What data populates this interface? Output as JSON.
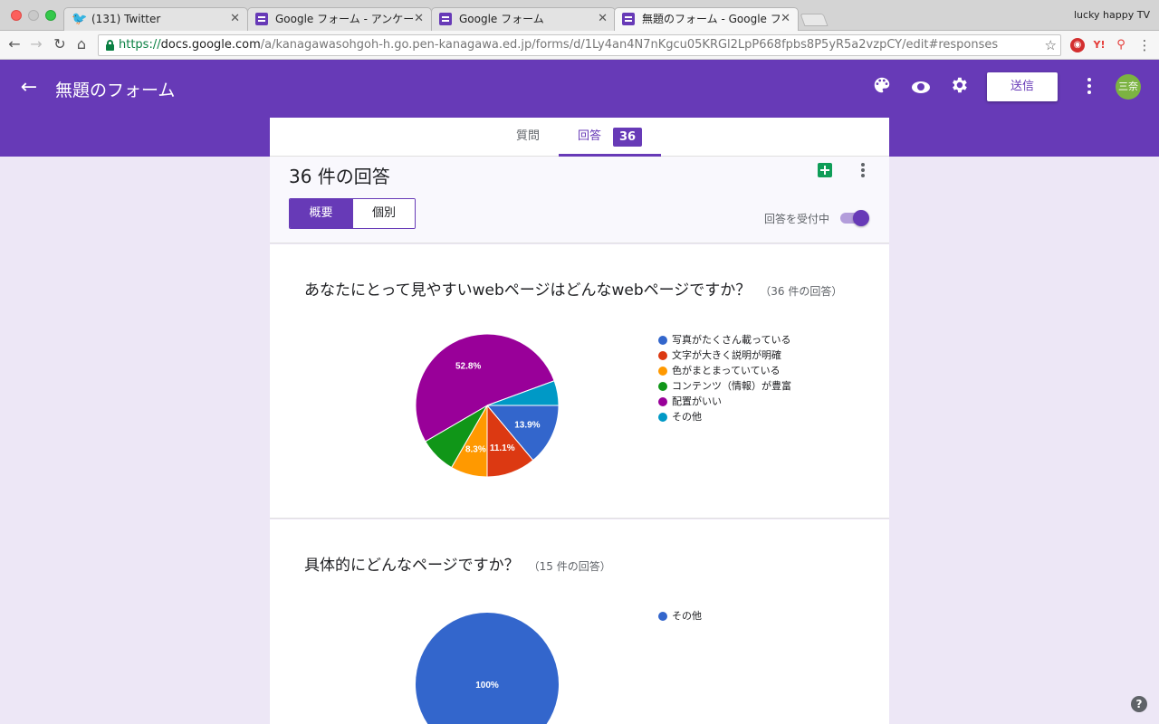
{
  "browser": {
    "profile_name": "lucky happy TV",
    "tabs": [
      {
        "title": "(131) Twitter",
        "icon": "twitter-icon"
      },
      {
        "title": "Google フォーム - アンケートを作",
        "icon": "forms-icon"
      },
      {
        "title": "Google フォーム",
        "icon": "forms-icon"
      },
      {
        "title": "無題のフォーム - Google フォーム",
        "icon": "forms-icon",
        "active": true
      }
    ],
    "url": {
      "scheme": "https://",
      "host": "docs.google.com",
      "path": "/a/kanagawasohgoh-h.go.pen-kanagawa.ed.jp/forms/d/1Ly4an4N7nKgcu05KRGl2LpP668fpbs8P5yR5a2vzpCY/edit#responses"
    }
  },
  "header": {
    "form_title": "無題のフォーム",
    "send_label": "送信",
    "avatar_text": "三奈",
    "accent_color": "#673ab7"
  },
  "tabs": {
    "questions_label": "質問",
    "responses_label": "回答",
    "responses_count": "36"
  },
  "summary": {
    "response_count_text": "36 件の回答",
    "view_summary": "概要",
    "view_individual": "個別",
    "accepting_label": "回答を受付中",
    "accepting": true
  },
  "questions": [
    {
      "title": "あなたにとって見やすいwebページはどんなwebページですか？",
      "count_text": "（36 件の回答）",
      "legend": [
        {
          "label": "写真がたくさん載っている",
          "color": "#3366cc"
        },
        {
          "label": "文字が大きく説明が明確",
          "color": "#dc3912"
        },
        {
          "label": "色がまとまっていている",
          "color": "#ff9900"
        },
        {
          "label": "コンテンツ（情報）が豊富",
          "color": "#109618"
        },
        {
          "label": "配置がいい",
          "color": "#990099"
        },
        {
          "label": "その他",
          "color": "#0099c6"
        }
      ]
    },
    {
      "title": "具体的にどんなページですか？",
      "count_text": "（15 件の回答）",
      "legend": [
        {
          "label": "その他",
          "color": "#3366cc"
        }
      ]
    }
  ],
  "chart_data": [
    {
      "type": "pie",
      "categories": [
        "写真がたくさん載っている",
        "文字が大きく説明が明確",
        "色がまとまっていている",
        "コンテンツ（情報）が豊富",
        "配置がいい",
        "その他"
      ],
      "values": [
        13.9,
        11.1,
        8.3,
        8.3,
        52.8,
        5.6
      ],
      "labels": [
        "13.9%",
        "11.1%",
        "8.3%",
        "",
        "52.8%",
        ""
      ],
      "colors": [
        "#3366cc",
        "#dc3912",
        "#ff9900",
        "#109618",
        "#990099",
        "#0099c6"
      ]
    },
    {
      "type": "pie",
      "categories": [
        "その他"
      ],
      "values": [
        100
      ],
      "labels": [
        "100%"
      ],
      "colors": [
        "#3366cc"
      ]
    }
  ]
}
